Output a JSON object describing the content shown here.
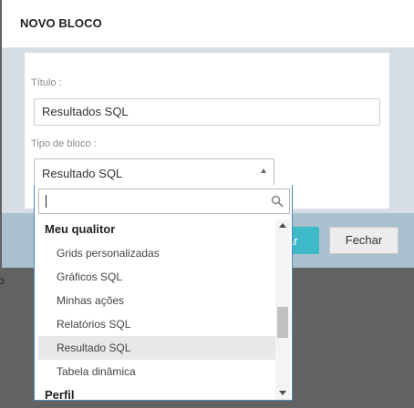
{
  "backdrop": {
    "partial_text": "o"
  },
  "modal": {
    "title": "NOVO BLOCO",
    "title_label": "Título :",
    "title_value": "Resultados SQL",
    "block_type_label": "Tipo de bloco :",
    "block_type_value": "Resultado SQL",
    "save_button_partial": "ar",
    "close_button": "Fechar"
  },
  "dropdown": {
    "search_value": "",
    "groups": [
      {
        "label": "Meu qualitor",
        "options": [
          "Grids personalizadas",
          "Gráficos SQL",
          "Minhas ações",
          "Relatórios SQL",
          "Resultado SQL",
          "Tabela dinâmica"
        ]
      },
      {
        "label": "Perfil",
        "options": []
      }
    ],
    "selected_option": "Resultado SQL"
  },
  "colors": {
    "primary_button": "#3eb9c7",
    "footer": "#a9c1cf",
    "dropdown_border": "#4a8db5",
    "selected_row": "#e8e8e8"
  }
}
